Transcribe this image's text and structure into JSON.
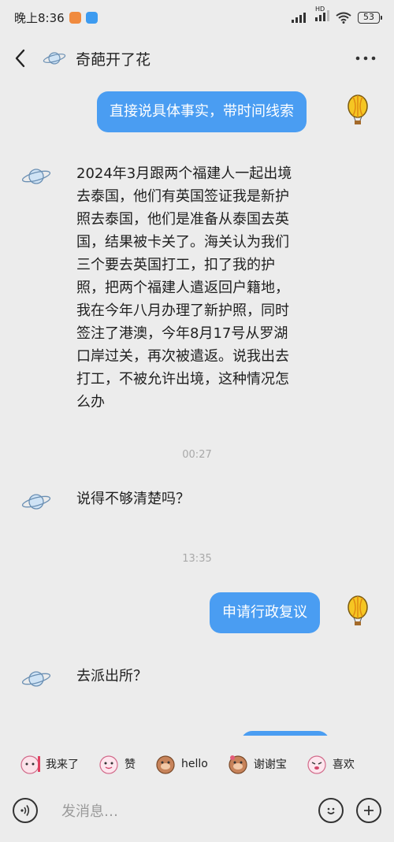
{
  "status_bar": {
    "time": "晚上8:36",
    "battery": "53",
    "network": "HD"
  },
  "header": {
    "title": "奇葩开了花"
  },
  "messages": [
    {
      "side": "out",
      "text": "直接说具体事实，带时间线索"
    },
    {
      "side": "in",
      "lines": [
        "2024年3月跟两个福建人一起出境",
        "去泰国，他们有英国签证我是新护",
        "照去泰国，他们是准备从泰国去英",
        "国，结果被卡关了。海关认为我们",
        "三个要去英国打工，扣了我的护",
        "照，把两个福建人遣返回户籍地，",
        "我在今年八月办理了新护照，同时",
        "签注了港澳，今年8月17号从罗湖",
        "口岸过关，再次被遣返。说我出去",
        "打工，不被允许出境，这种情况怎",
        "么办"
      ]
    },
    {
      "side": "time",
      "text": "00:27"
    },
    {
      "side": "in",
      "text": "说得不够清楚吗？"
    },
    {
      "side": "time",
      "text": "13:35"
    },
    {
      "side": "out",
      "text": "申请行政复议"
    },
    {
      "side": "in",
      "text": "去派出所？"
    }
  ],
  "stickers": [
    {
      "label": "我来了"
    },
    {
      "label": "赞"
    },
    {
      "label": "hello"
    },
    {
      "label": "谢谢宝"
    },
    {
      "label": "喜欢"
    }
  ],
  "input": {
    "placeholder": "发消息…"
  },
  "colors": {
    "bubble_out": "#4a9df2",
    "background": "#ececec"
  }
}
